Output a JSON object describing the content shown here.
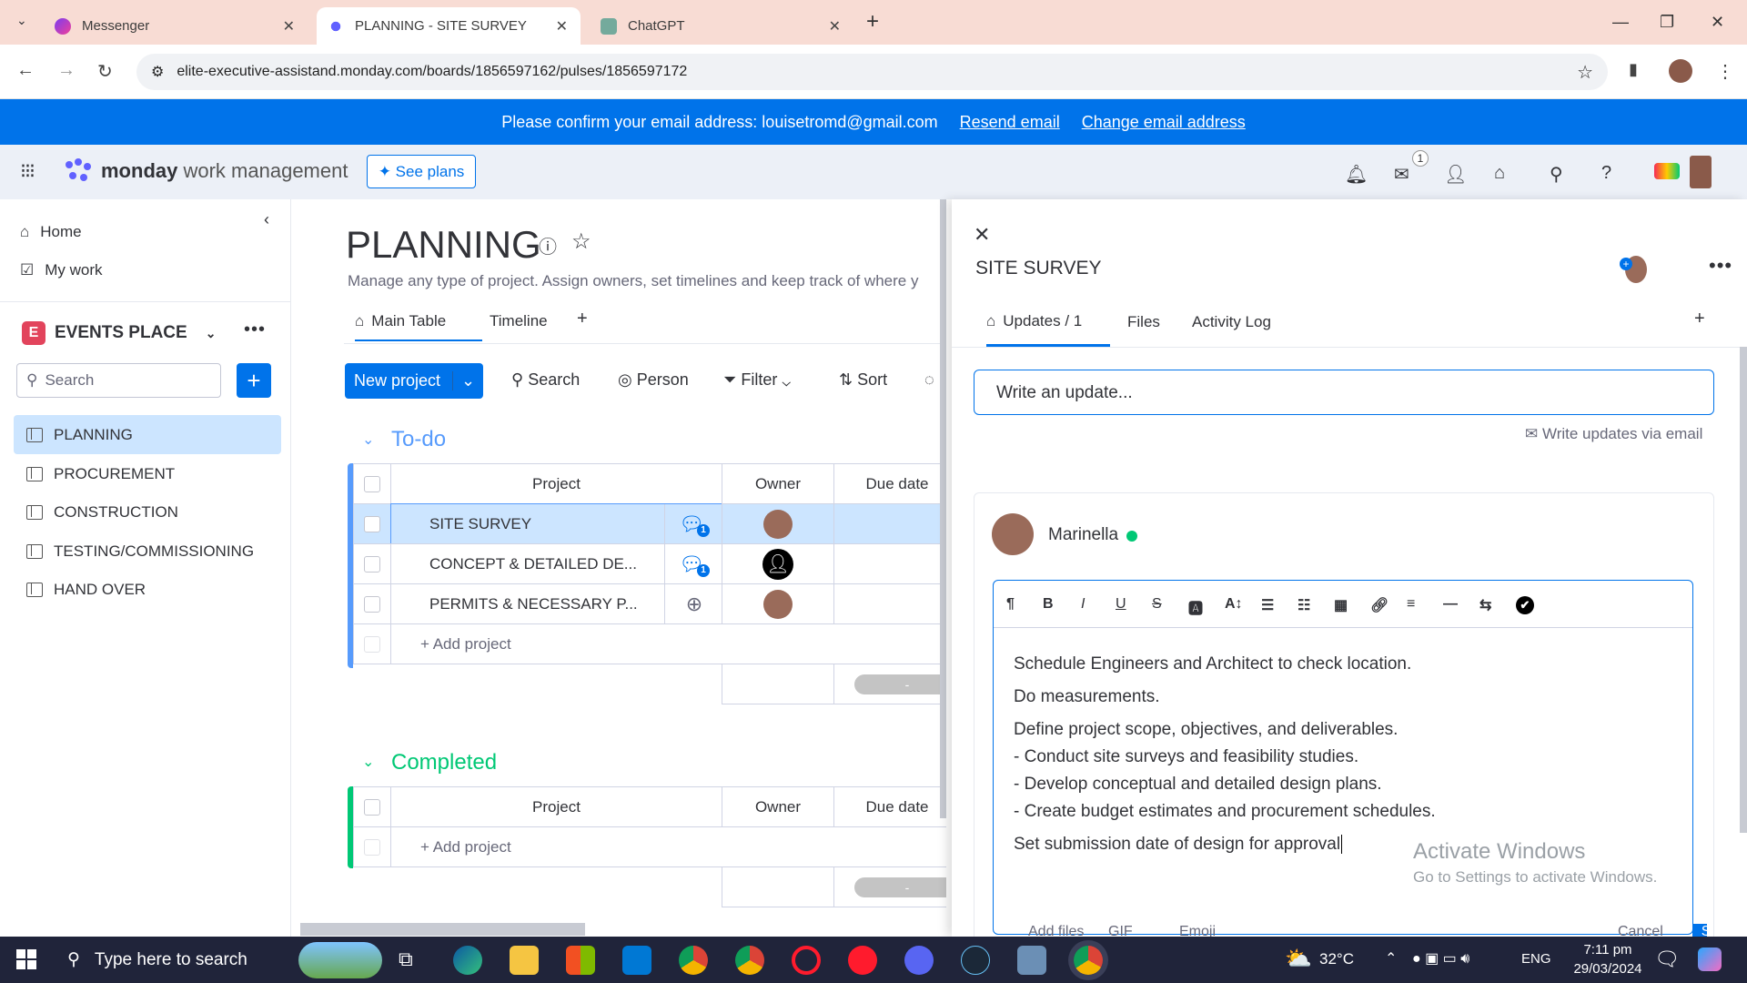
{
  "browser": {
    "tabs": [
      {
        "title": "Messenger",
        "active": false
      },
      {
        "title": "PLANNING - SITE SURVEY",
        "active": true
      },
      {
        "title": "ChatGPT",
        "active": false
      }
    ],
    "url": "elite-executive-assistand.monday.com/boards/1856597162/pulses/1856597172"
  },
  "banner": {
    "message": "Please confirm your email address: louisetromd@gmail.com",
    "resend": "Resend email",
    "change": "Change email address"
  },
  "header": {
    "brand_bold": "monday",
    "brand_rest": "work management",
    "see_plans": "See plans",
    "inbox_count": "1"
  },
  "sidebar": {
    "home": "Home",
    "my_work": "My work",
    "workspace_letter": "E",
    "workspace": "EVENTS PLACE",
    "search_placeholder": "Search",
    "boards": [
      "PLANNING",
      "PROCUREMENT",
      "CONSTRUCTION",
      "TESTING/COMMISSIONING",
      "HAND OVER"
    ],
    "selected_board": "PLANNING"
  },
  "board": {
    "title": "PLANNING",
    "description": "Manage any type of project. Assign owners, set timelines and keep track of where y",
    "views": [
      "Main Table",
      "Timeline"
    ],
    "new_button": "New project",
    "toolbar": [
      "Search",
      "Person",
      "Filter",
      "Sort"
    ],
    "groups": [
      {
        "name": "To-do",
        "color": "#579bfc",
        "columns": [
          "Project",
          "Owner",
          "Due date"
        ],
        "rows": [
          "SITE SURVEY",
          "CONCEPT & DETAILED DE...",
          "PERMITS & NECESSARY P..."
        ],
        "update_counts": [
          "1",
          "1",
          ""
        ],
        "add_label": "+ Add project",
        "summary": "-"
      },
      {
        "name": "Completed",
        "color": "#00c875",
        "columns": [
          "Project",
          "Owner",
          "Due date"
        ],
        "rows": [],
        "add_label": "+ Add project",
        "summary": "-"
      }
    ]
  },
  "item_panel": {
    "title": "SITE SURVEY",
    "tabs": [
      "Updates / 1",
      "Files",
      "Activity Log"
    ],
    "write_placeholder": "Write an update...",
    "via_email": "Write updates via email",
    "author": "Marinella",
    "online_color": "#00c875",
    "content": [
      "Schedule Engineers and Architect to check location.",
      "Do measurements.",
      "Define project scope, objectives, and deliverables.",
      "- Conduct site surveys and feasibility studies.",
      "- Develop conceptual and detailed design plans.",
      "- Create budget estimates and procurement schedules.",
      "Set submission date of design for approval"
    ],
    "footer": [
      "Add files",
      "GIF",
      "Emoji",
      "Cancel",
      "Save"
    ]
  },
  "watermark": {
    "line1": "Activate Windows",
    "line2": "Go to Settings to activate Windows."
  },
  "taskbar": {
    "search_placeholder": "Type here to search",
    "weather": "32°C",
    "lang": "ENG",
    "time": "7:11 pm",
    "date": "29/03/2024"
  },
  "colors": {
    "primary": "#0073ea",
    "selected_row": "#cce5ff",
    "tabstrip": "#f8dcd4"
  }
}
